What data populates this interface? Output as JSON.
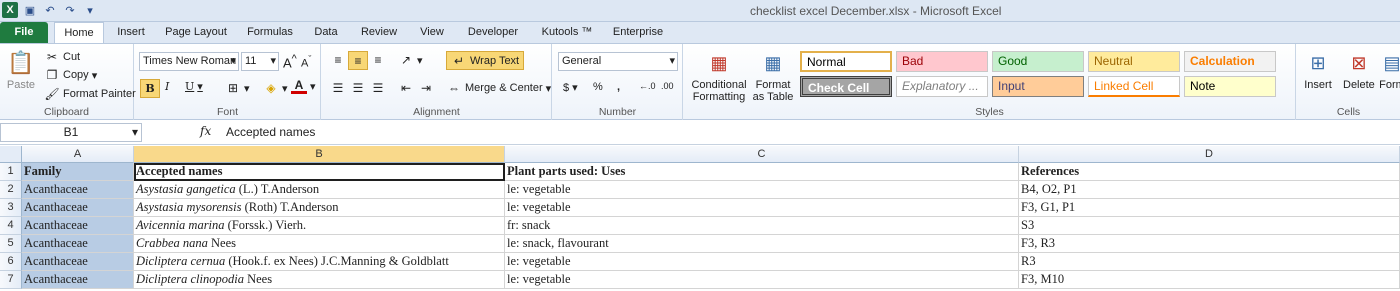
{
  "title": "checklist excel December.xlsx  -  Microsoft Excel",
  "tabs": [
    "File",
    "Home",
    "Insert",
    "Page Layout",
    "Formulas",
    "Data",
    "Review",
    "View",
    "Developer",
    "Kutools ™",
    "Enterprise"
  ],
  "clipboard": {
    "paste": "Paste",
    "cut": "Cut",
    "copy": "Copy",
    "format_painter": "Format Painter",
    "label": "Clipboard"
  },
  "font": {
    "name": "Times New Roman",
    "size": "11",
    "label": "Font"
  },
  "alignment": {
    "wrap_text": "Wrap Text",
    "merge_center": "Merge & Center",
    "label": "Alignment"
  },
  "number": {
    "format": "General",
    "label": "Number"
  },
  "styles": {
    "conditional": "Conditional Formatting",
    "format_table": "Format as Table",
    "label": "Styles",
    "cells": [
      {
        "name": "Normal",
        "bg": "#ffffff",
        "fg": "#000000"
      },
      {
        "name": "Bad",
        "bg": "#ffc7ce",
        "fg": "#9c0006"
      },
      {
        "name": "Good",
        "bg": "#c6efce",
        "fg": "#006100"
      },
      {
        "name": "Neutral",
        "bg": "#ffeb9c",
        "fg": "#9c6500"
      },
      {
        "name": "Calculation",
        "bg": "#f2f2f2",
        "fg": "#fa7d00"
      },
      {
        "name": "Check Cell",
        "bg": "#a5a5a5",
        "fg": "#ffffff"
      },
      {
        "name": "Explanatory ...",
        "bg": "#ffffff",
        "fg": "#7f7f7f"
      },
      {
        "name": "Input",
        "bg": "#ffcc99",
        "fg": "#3f3f76"
      },
      {
        "name": "Linked Cell",
        "bg": "#ffffff",
        "fg": "#fa7d00"
      },
      {
        "name": "Note",
        "bg": "#ffffcc",
        "fg": "#000000"
      }
    ]
  },
  "cells_group": {
    "insert": "Insert",
    "delete": "Delete",
    "format": "Form",
    "label": "Cells"
  },
  "formula_bar": {
    "name_box": "B1",
    "fx": "fx",
    "value": "Accepted names"
  },
  "columns": [
    "A",
    "B",
    "C",
    "D"
  ],
  "rows": [
    {
      "num": "1",
      "a": "Family",
      "b_italic": "Accepted names",
      "b_rest": "",
      "c": "Plant parts used: Uses",
      "d": "References",
      "header": true
    },
    {
      "num": "2",
      "a": "Acanthaceae",
      "b_italic": "Asystasia gangetica",
      "b_rest": " (L.) T.Anderson",
      "c": "le: vegetable",
      "d": "B4, O2, P1"
    },
    {
      "num": "3",
      "a": "Acanthaceae",
      "b_italic": "Asystasia mysorensis",
      "b_rest": " (Roth) T.Anderson",
      "c": "le: vegetable",
      "d": "F3, G1, P1"
    },
    {
      "num": "4",
      "a": "Acanthaceae",
      "b_italic": "Avicennia marina",
      "b_rest": " (Forssk.) Vierh.",
      "c": "fr: snack",
      "d": "S3"
    },
    {
      "num": "5",
      "a": "Acanthaceae",
      "b_italic": "Crabbea nana",
      "b_rest": " Nees",
      "c": "le: snack, flavourant",
      "d": "F3, R3"
    },
    {
      "num": "6",
      "a": "Acanthaceae",
      "b_italic": "Dicliptera cernua",
      "b_rest": " (Hook.f. ex Nees) J.C.Manning & Goldblatt",
      "c": "le: vegetable",
      "d": "R3"
    },
    {
      "num": "7",
      "a": "Acanthaceae",
      "b_italic": "Dicliptera clinopodia",
      "b_rest": " Nees",
      "c": "le: vegetable",
      "d": "F3, M10"
    }
  ]
}
